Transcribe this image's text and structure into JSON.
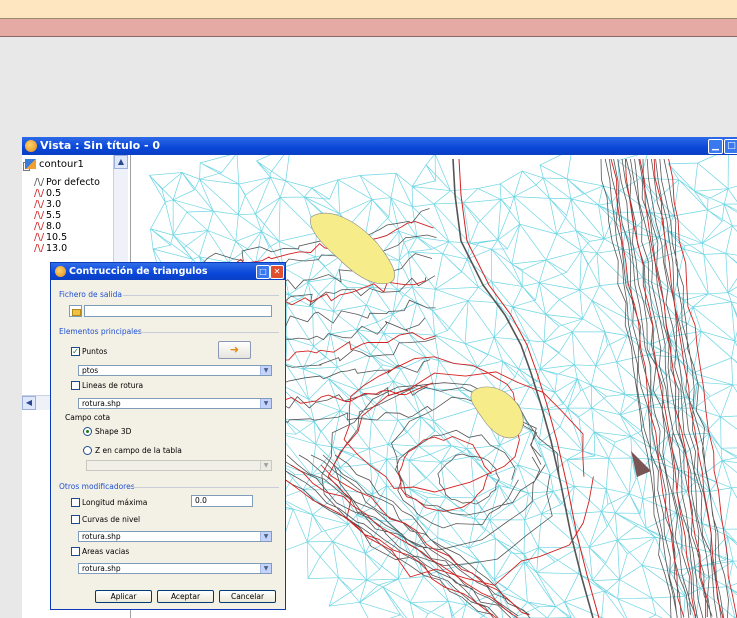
{
  "window": {
    "title": "Vista : Sin título - 0",
    "toc": {
      "layer_name": "contour1",
      "legend_items": [
        {
          "label": "Por defecto",
          "style": "gray"
        },
        {
          "label": "0.5",
          "style": "red"
        },
        {
          "label": "3.0",
          "style": "red"
        },
        {
          "label": "5.5",
          "style": "red"
        },
        {
          "label": "8.0",
          "style": "red"
        },
        {
          "label": "10.5",
          "style": "red"
        },
        {
          "label": "13.0",
          "style": "red"
        }
      ]
    },
    "colors": {
      "titlebar": "#0a46d6",
      "contour_red": "#d42020",
      "contour_gray": "#555555",
      "triangles_cyan": "#6fd6e4",
      "water_yellow": "#f6ec8a"
    }
  },
  "dialog": {
    "title": "Contrucción de triangulos",
    "output_group": "Fichero de salida",
    "output_value": "",
    "main_group": "Elementos principales",
    "points_label": "Puntos",
    "points_checked": true,
    "points_layer": "ptos",
    "breaklines_label": "Lineas de rotura",
    "breaklines_checked": false,
    "breaklines_layer": "rotura.shp",
    "elevation_field_label": "Campo cota",
    "shape3d_label": "Shape 3D",
    "z_field_label": "Z en campo de la tabla",
    "z_field_value": "",
    "modifiers_group": "Otros modificadores",
    "max_length_label": "Longitud máxima",
    "max_length_checked": false,
    "max_length_value": "0.0",
    "contours_label": "Curvas de nivel",
    "contours_checked": false,
    "contours_layer": "rotura.shp",
    "empty_areas_label": "Areas vacias",
    "empty_areas_checked": false,
    "empty_areas_layer": "rotura.shp",
    "buttons": {
      "apply": "Aplicar",
      "accept": "Aceptar",
      "cancel": "Cancelar"
    }
  }
}
